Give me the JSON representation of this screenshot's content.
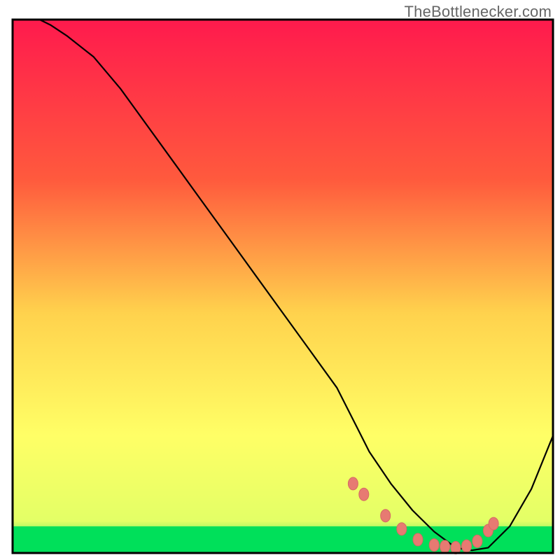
{
  "watermark": "TheBottlenecker.com",
  "chart_data": {
    "type": "line",
    "title": "",
    "xlabel": "",
    "ylabel": "",
    "xlim": [
      0,
      100
    ],
    "ylim": [
      0,
      100
    ],
    "grid": false,
    "series": [
      {
        "name": "curve",
        "x_pct": [
          5,
          7,
          10,
          15,
          20,
          25,
          30,
          35,
          40,
          45,
          50,
          55,
          60,
          63,
          66,
          70,
          74,
          78,
          82,
          85,
          88,
          92,
          96,
          100
        ],
        "y_pct": [
          100,
          99,
          97,
          93,
          87,
          80,
          73,
          66,
          59,
          52,
          45,
          38,
          31,
          25,
          19,
          13,
          8,
          4,
          1,
          0.5,
          1,
          5,
          12,
          22
        ]
      }
    ],
    "markers": {
      "x_pct": [
        63,
        65,
        69,
        72,
        75,
        78,
        80,
        82,
        84,
        86,
        88,
        89
      ],
      "y_pct": [
        13,
        11,
        7,
        4.5,
        2.5,
        1.5,
        1.2,
        1,
        1.3,
        2.2,
        4.2,
        5.5
      ]
    },
    "optimal_band": {
      "y_from_pct": 0,
      "y_to_pct": 5
    },
    "colors": {
      "gradient_top": "#ff1a4d",
      "gradient_mid1": "#ff7a33",
      "gradient_mid2": "#ffd24d",
      "gradient_mid3": "#ffff66",
      "gradient_bottom": "#00e05a",
      "curve": "#000000",
      "marker_fill": "#e77a72",
      "marker_stroke": "#d56a63",
      "border": "#000000"
    }
  }
}
